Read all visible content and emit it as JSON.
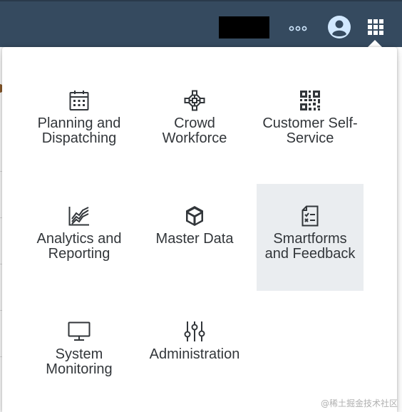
{
  "shellbar": {
    "overflow_icon": "overflow-icon",
    "avatar_icon": "user-avatar-icon",
    "products_icon": "grid-icon"
  },
  "menu": {
    "items": [
      {
        "label": "Planning and Dispatching",
        "icon": "calendar-icon"
      },
      {
        "label": "Crowd Workforce",
        "icon": "network-icon"
      },
      {
        "label": "Customer Self-Service",
        "icon": "qr-code-icon"
      },
      {
        "label": "Analytics and Reporting",
        "icon": "line-chart-icon"
      },
      {
        "label": "Master Data",
        "icon": "cube-icon"
      },
      {
        "label": "Smartforms and Feedback",
        "icon": "checklist-document-icon"
      },
      {
        "label": "System Monitoring",
        "icon": "monitor-icon"
      },
      {
        "label": "Administration",
        "icon": "sliders-icon"
      }
    ]
  },
  "watermark": "@稀土掘金技术社区",
  "colors": {
    "shellbar": "#354a5f",
    "icon_light": "#d1e8ff",
    "text": "#32363a",
    "hover": "#eaedf0"
  }
}
